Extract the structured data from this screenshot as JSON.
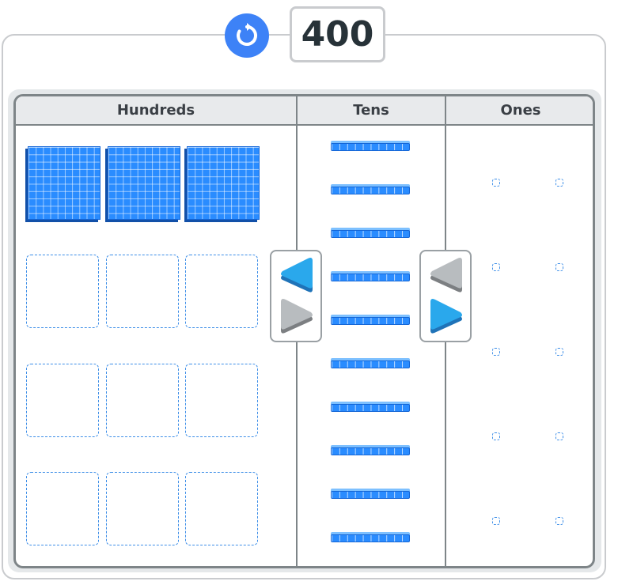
{
  "display": {
    "value": "400"
  },
  "columns": {
    "hundreds": "Hundreds",
    "tens": "Tens",
    "ones": "Ones"
  },
  "hundreds": {
    "filled": 3,
    "empty": 9
  },
  "tens": {
    "filled": 10
  },
  "ones": {
    "filled": 0,
    "empty": 10
  },
  "colors": {
    "accent": "#3d82f7",
    "block": "#2a8cff",
    "arrow_active": "#2aa8ec",
    "arrow_inactive": "#b8bcbf"
  }
}
